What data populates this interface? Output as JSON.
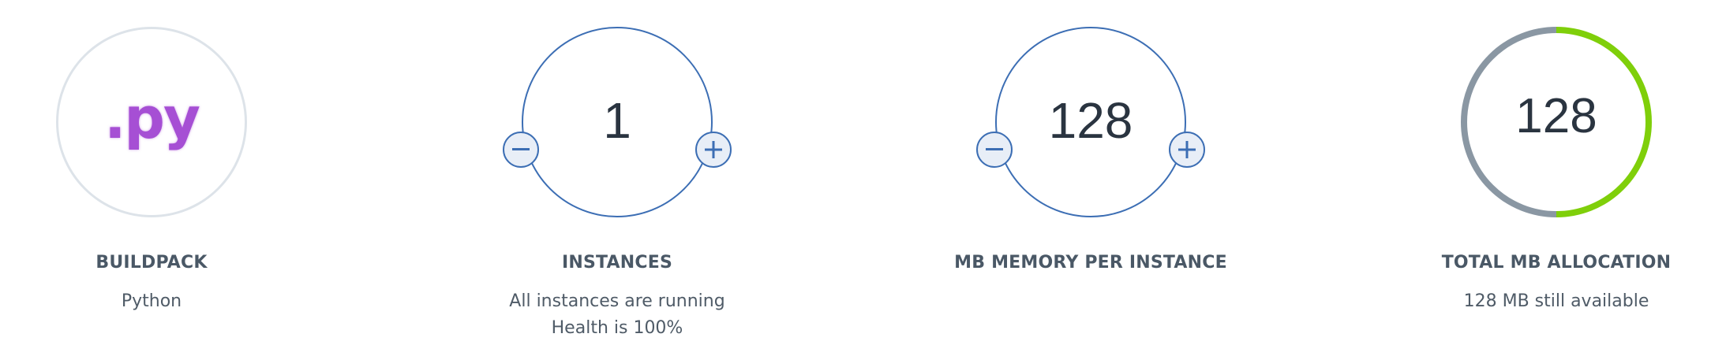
{
  "buildpack": {
    "logo_text": ".py",
    "label": "BUILDPACK",
    "value": "Python"
  },
  "instances": {
    "count": "1",
    "label": "INSTANCES",
    "status_line1": "All instances are running",
    "status_line2": "Health is 100%",
    "decrement_icon": "minus-icon",
    "increment_icon": "plus-icon"
  },
  "memory": {
    "value": "128",
    "label": "MB MEMORY PER INSTANCE",
    "decrement_icon": "minus-icon",
    "increment_icon": "plus-icon"
  },
  "total": {
    "value": "128",
    "label": "TOTAL MB ALLOCATION",
    "available_text": "128 MB still available",
    "used_fraction": 0.5,
    "colors": {
      "used": "#8a97a3",
      "available": "#7fcf0a"
    }
  },
  "colors": {
    "stepper_border": "#3c6eb4",
    "button_fill": "#e8eef7",
    "buildpack_ring": "#dde3e9",
    "logo": "#a64fd4"
  }
}
